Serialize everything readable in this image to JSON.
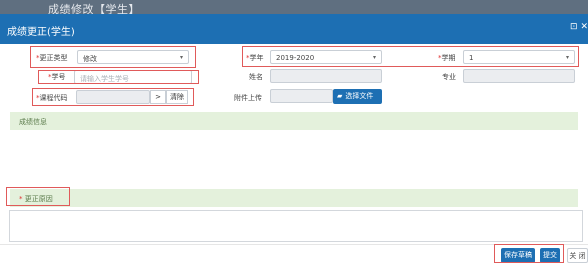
{
  "background": {
    "page_title": "成绩修改【学生】"
  },
  "modal": {
    "title": "成绩更正(学生)",
    "header_icons": "⊡ ✕"
  },
  "form": {
    "correction_type": {
      "label": "更正类型",
      "value": "修改"
    },
    "school_year": {
      "label": "学年",
      "value": "2019-2020"
    },
    "semester": {
      "label": "学期",
      "value": "1"
    },
    "student_id": {
      "label": "学号",
      "placeholder": "请输入学生学号"
    },
    "name": {
      "label": "姓名",
      "value": ""
    },
    "major": {
      "label": "专业",
      "value": ""
    },
    "course_code": {
      "label": "课程代码",
      "value": "",
      "picker": ">",
      "clear": "清除"
    },
    "attachment": {
      "label": "附件上传",
      "value": "",
      "button": "选择文件"
    }
  },
  "sections": {
    "grade_info": "成绩信息",
    "reason": "更正原因"
  },
  "footer": {
    "save_draft": "保存草稿",
    "submit": "提交",
    "close": "关 闭"
  },
  "colors": {
    "header_blue": "#1d6fb3",
    "info_band": "#e4f1dc",
    "highlight_red": "#e05a5a"
  }
}
